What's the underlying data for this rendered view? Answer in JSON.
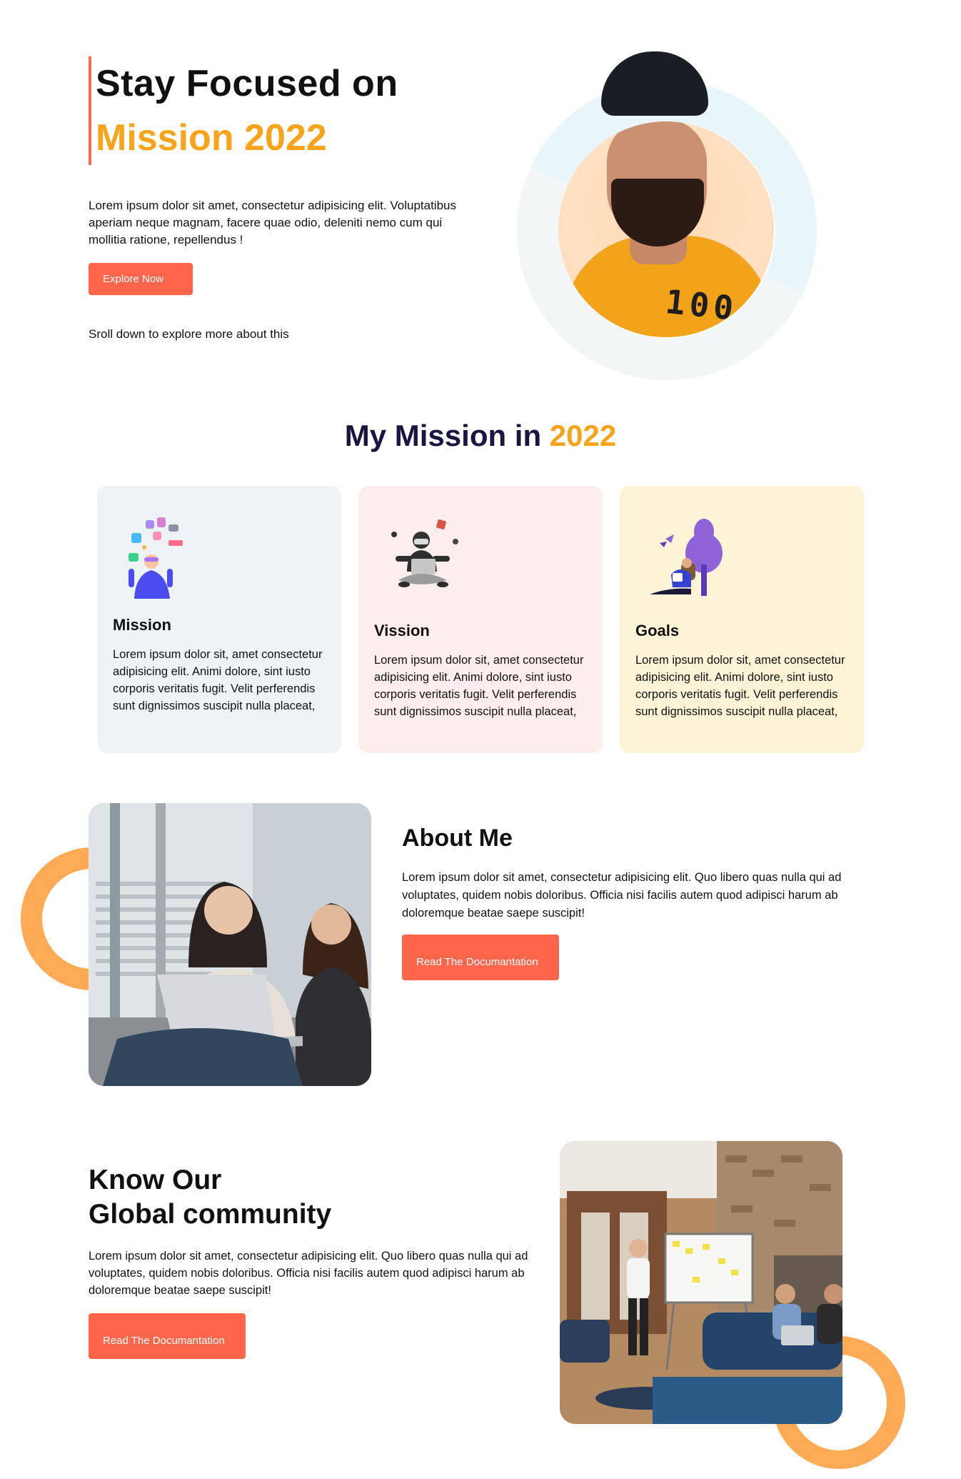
{
  "hero": {
    "title_line1": "Stay Focused on",
    "title_line2": "Mission 2022",
    "description": "Lorem ipsum dolor sit amet, consectetur adipisicing elit. Voluptatibus aperiam neque magnam, facere quae odio, deleniti nemo cum qui mollitia ratione, repellendus !",
    "button_label": "Explore Now",
    "scroll_hint": "Sroll down to explore more about this",
    "shirt_print": "100"
  },
  "mission": {
    "title_prefix": "My Mission in ",
    "title_accent": "2022",
    "cards": [
      {
        "title": "Mission",
        "text": "Lorem ipsum dolor sit, amet consectetur adipisicing elit. Animi dolore, sint iusto corporis veritatis fugit. Velit perferendis sunt dignissimos suscipit nulla placeat,"
      },
      {
        "title": "Vission",
        "text": "Lorem ipsum dolor sit, amet consectetur adipisicing elit. Animi dolore, sint iusto corporis veritatis fugit. Velit perferendis sunt dignissimos suscipit nulla placeat,"
      },
      {
        "title": "Goals",
        "text": "Lorem ipsum dolor sit, amet consectetur adipisicing elit. Animi dolore, sint iusto corporis veritatis fugit. Velit perferendis sunt dignissimos suscipit nulla placeat,"
      }
    ]
  },
  "about": {
    "title": "About Me",
    "text": "Lorem ipsum dolor sit amet, consectetur adipisicing elit. Quo libero quas nulla qui ad voluptates, quidem nobis doloribus. Officia nisi facilis autem quod adipisci harum ab doloremque beatae saepe suscipit!",
    "button_label": "Read The Documantation"
  },
  "community": {
    "title_line1": "Know Our",
    "title_line2": "Global community",
    "text": "Lorem ipsum dolor sit amet, consectetur adipisicing elit. Quo libero quas nulla qui ad voluptates, quidem nobis doloribus. Officia nisi facilis autem quod adipisci harum ab doloremque beatae saepe suscipit!",
    "button_label": "Read The Documantation"
  },
  "colors": {
    "accent_orange": "#f9a31a",
    "button_red": "#ff654a",
    "heading_navy": "#1a1642",
    "ring_orange": "#ffaa55",
    "card_mission_bg": "#eef4f6",
    "card_vision_bg": "#fdeeed",
    "card_goals_bg": "#fdf4d7"
  }
}
